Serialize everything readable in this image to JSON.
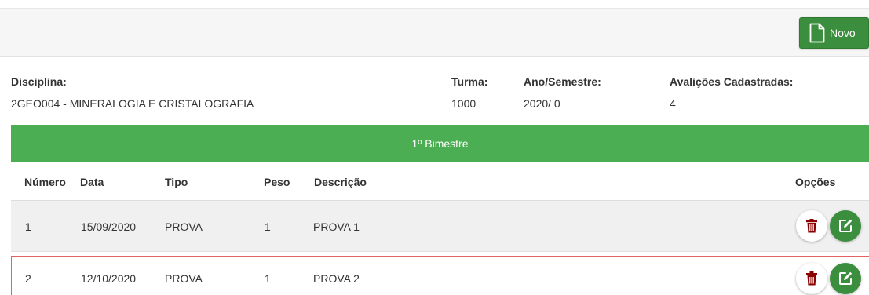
{
  "toolbar": {
    "novo_label": "Novo",
    "novo_icon": "new-document-icon"
  },
  "info": {
    "disciplina_label": "Disciplina:",
    "disciplina_value": "2GEO004 - MINERALOGIA E CRISTALOGRAFIA",
    "turma_label": "Turma:",
    "turma_value": "1000",
    "ano_label": "Ano/Semestre:",
    "ano_value": "2020/ 0",
    "avaliacoes_label": "Avalições Cadastradas:",
    "avaliacoes_value": "4"
  },
  "bimestre": {
    "title": "1º Bimestre"
  },
  "table": {
    "headers": {
      "numero": "Número",
      "data": "Data",
      "tipo": "Tipo",
      "peso": "Peso",
      "descricao": "Descrição",
      "opcoes": "Opções"
    },
    "rows": [
      {
        "numero": "1",
        "data": "15/09/2020",
        "tipo": "PROVA",
        "peso": "1",
        "descricao": "PROVA 1"
      },
      {
        "numero": "2",
        "data": "12/10/2020",
        "tipo": "PROVA",
        "peso": "1",
        "descricao": "PROVA 2"
      }
    ]
  },
  "colors": {
    "primary_green": "#3b8e3d",
    "header_green": "#4cae52",
    "delete_red": "#8b0000",
    "selected_row_border": "#e06262"
  },
  "icons": {
    "delete": "trash-icon",
    "edit": "edit-icon"
  }
}
